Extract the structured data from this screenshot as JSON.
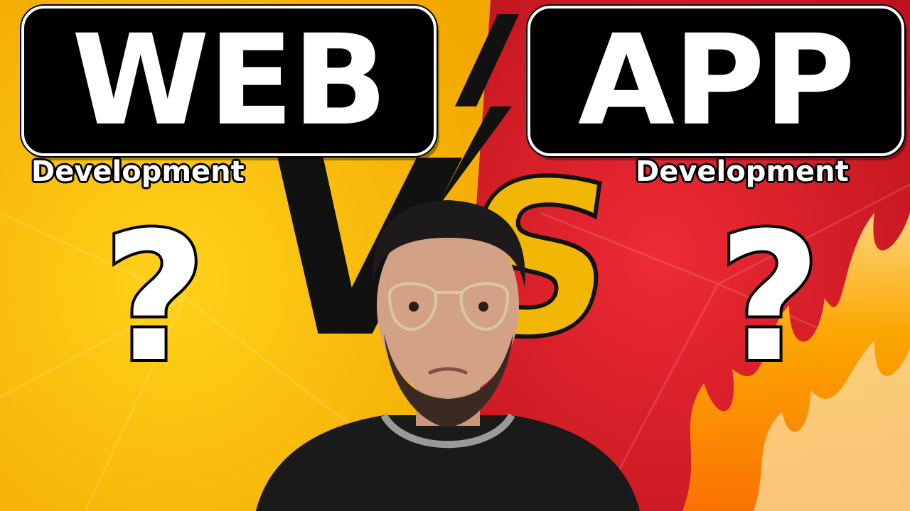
{
  "left": {
    "title": "WEB",
    "subtitle": "Development",
    "question": "?",
    "color": "#FFC400"
  },
  "right": {
    "title": "APP",
    "subtitle": "Development",
    "question": "?",
    "color": "#E0202A"
  },
  "versus": {
    "text": "VS",
    "letter_colors": [
      "#111111",
      "#F2B705"
    ]
  },
  "lightning_color": "#111111"
}
